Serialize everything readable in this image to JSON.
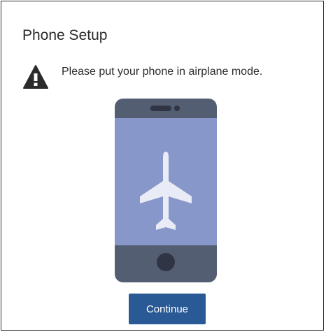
{
  "dialog": {
    "title": "Phone Setup",
    "message": "Please put your phone in airplane mode.",
    "warning_icon": "warning-triangle-icon",
    "illustration": "airplane-mode-phone-illustration",
    "continue_label": "Continue"
  },
  "colors": {
    "button_bg": "#2a5a95",
    "phone_frame": "#545e72",
    "phone_screen": "#8797c9",
    "airplane": "#e9ecf6",
    "warning": "#2b2b2b"
  }
}
